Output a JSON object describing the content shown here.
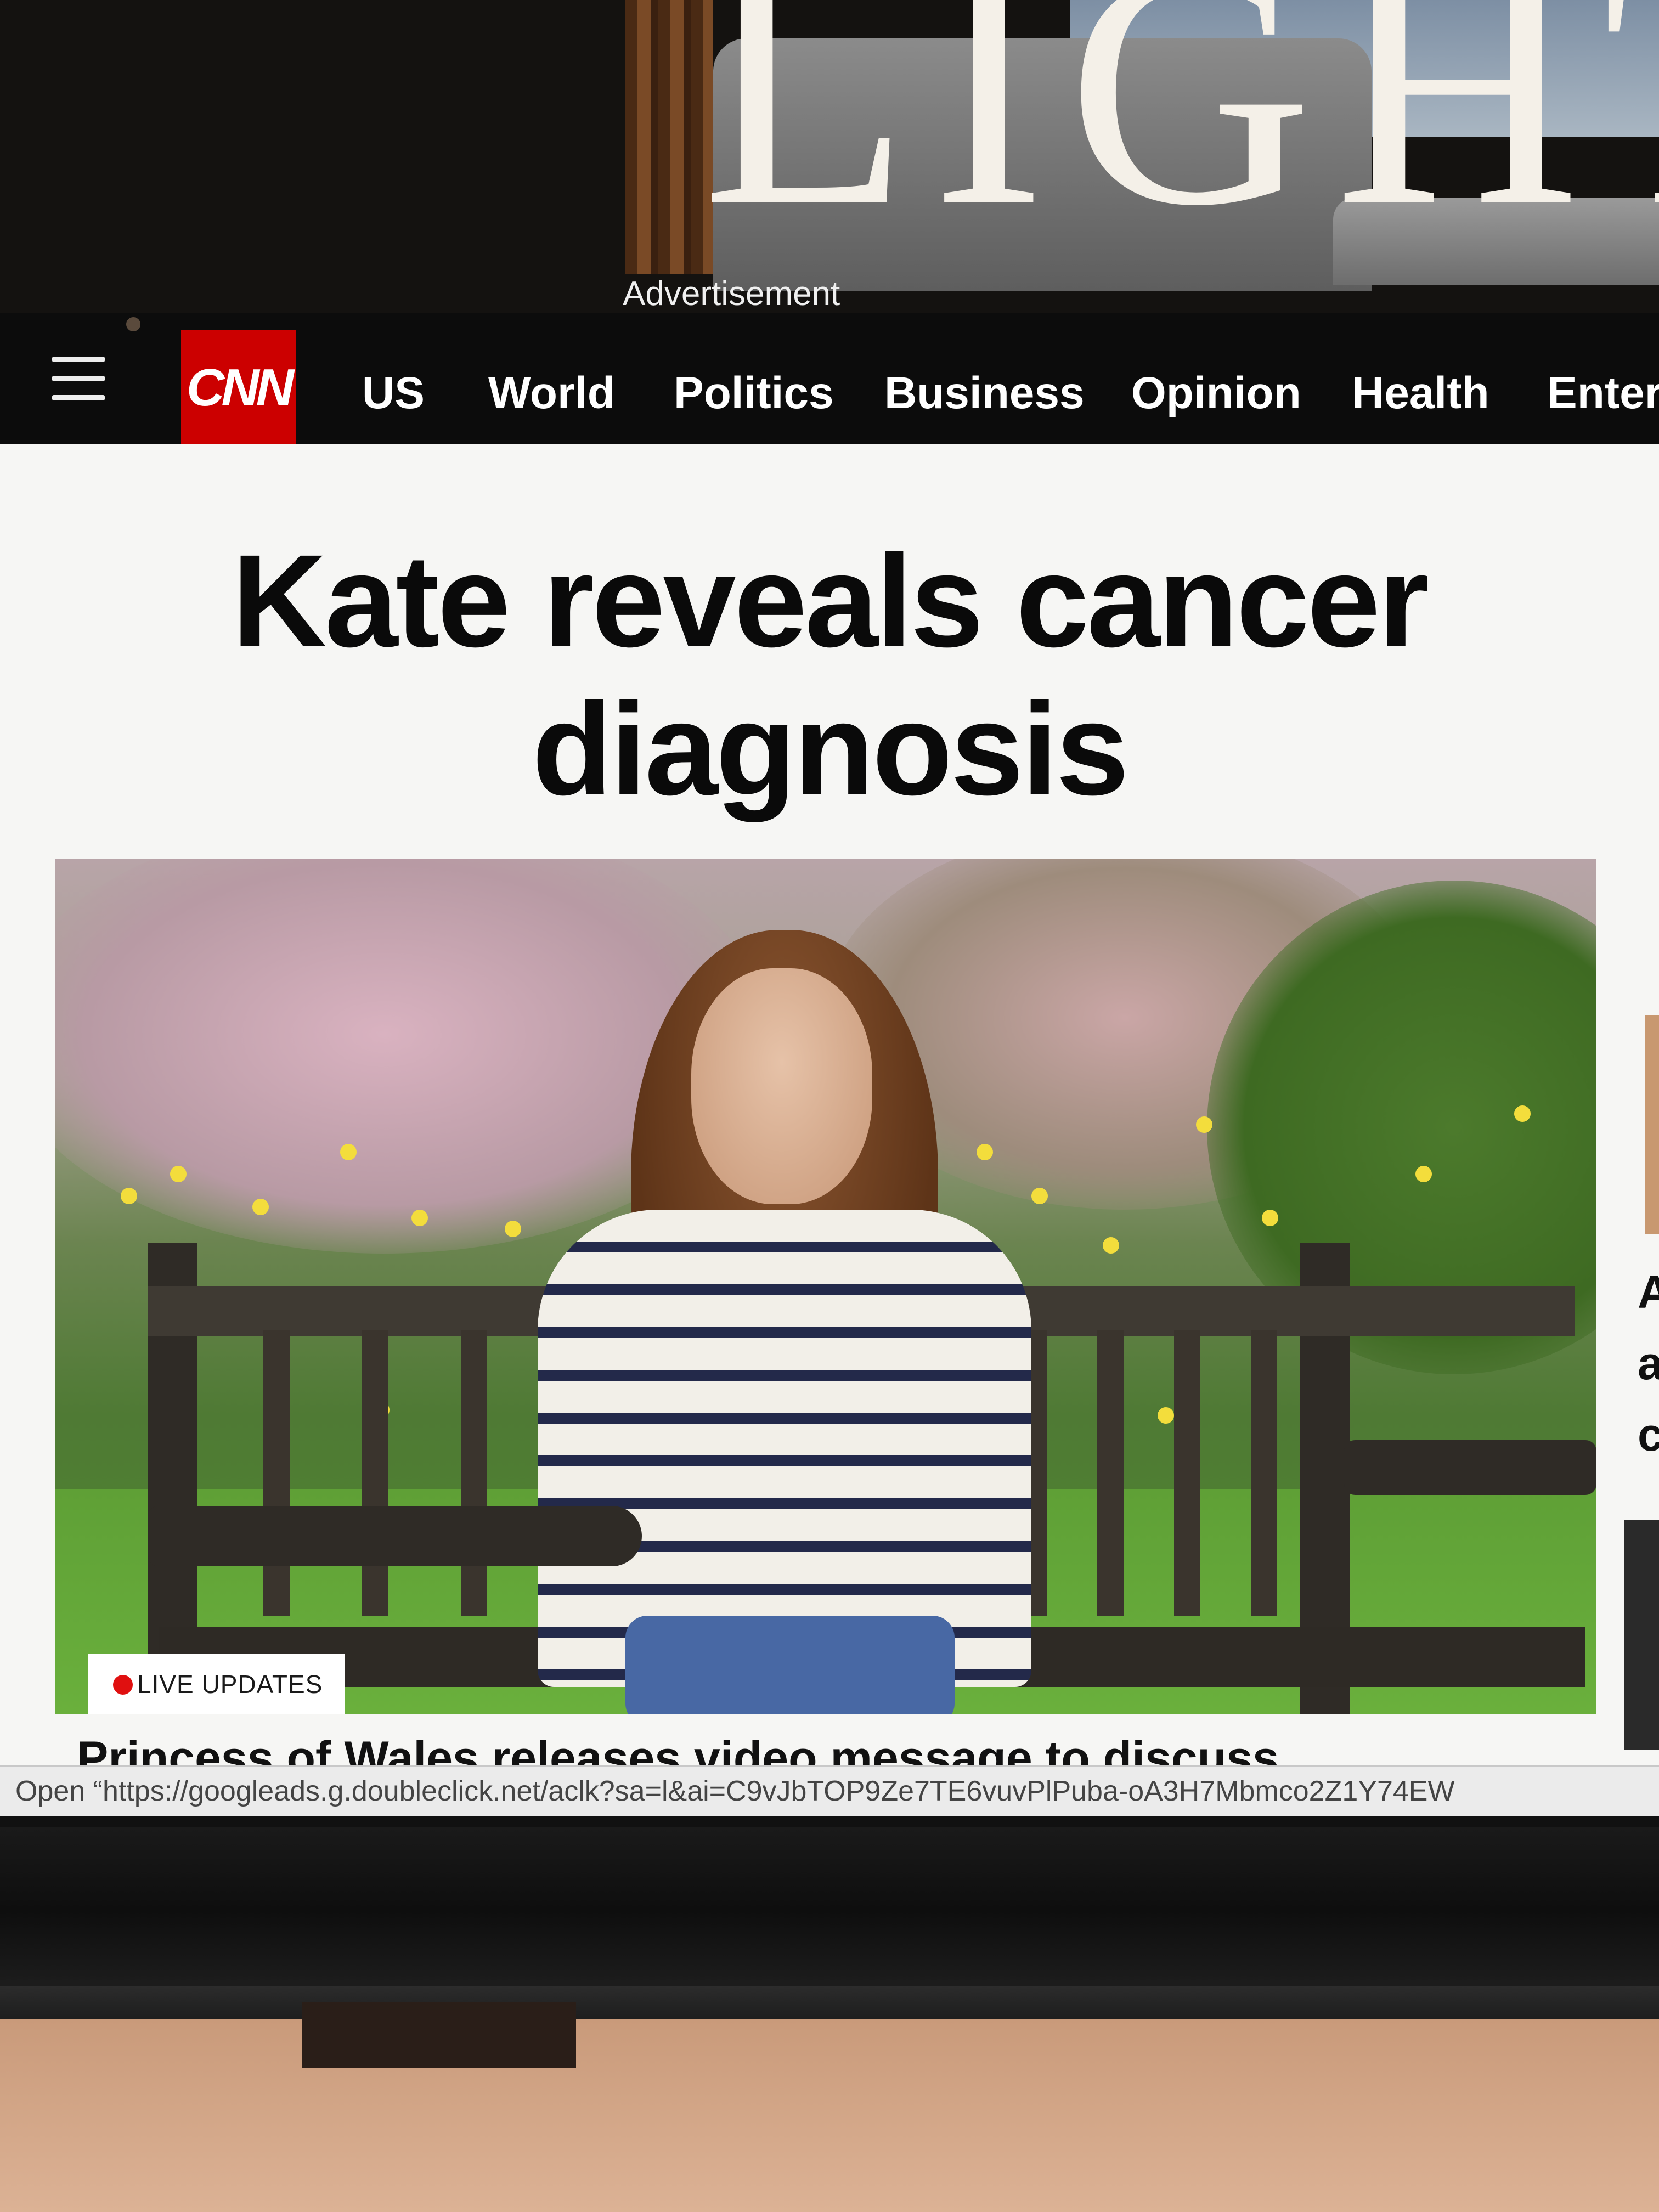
{
  "advertisement": {
    "label": "Advertisement",
    "wordmark": "LIGHT"
  },
  "nav": {
    "logo": "CNN",
    "links": [
      "US",
      "World",
      "Politics",
      "Business",
      "Opinion",
      "Health",
      "Enter"
    ]
  },
  "headline": "Kate reveals cancer diagnosis",
  "hero": {
    "badge": "LIVE UPDATES",
    "badge_color": "#e01010"
  },
  "subheadline": "Princess of Wales releases video message to discuss",
  "right_rail": {
    "fragment_lines": [
      "A",
      "a",
      "c"
    ]
  },
  "status_bar": {
    "text": "Open “https://googleads.g.doubleclick.net/aclk?sa=l&ai=C9vJbTOP9Ze7TE6vuvPlPuba-oA3H7Mbmco2Z1Y74EW"
  },
  "colors": {
    "brand_red": "#cc0000",
    "nav_bg": "#0c0c0c"
  }
}
